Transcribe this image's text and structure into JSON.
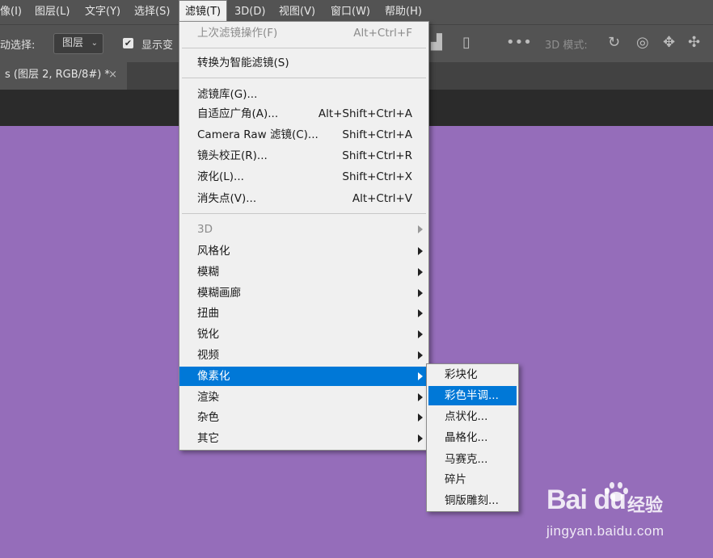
{
  "menubar": {
    "items": [
      "像(I)",
      "图层(L)",
      "文字(Y)",
      "选择(S)",
      "滤镜(T)",
      "3D(D)",
      "视图(V)",
      "窗口(W)",
      "帮助(H)"
    ],
    "active_index": 4
  },
  "options_bar": {
    "auto_select_label": "动选择:",
    "auto_select_value": "图层",
    "show_transform_label": "显示变",
    "mode_3d_label": "3D 模式:"
  },
  "document_tab": {
    "title": "s (图层 2, RGB/8#) *",
    "close": "×"
  },
  "filter_menu": {
    "items": [
      {
        "label": "上次滤镜操作(F)",
        "shortcut": "Alt+Ctrl+F",
        "disabled": true
      },
      {
        "separator": true
      },
      {
        "label": "转换为智能滤镜(S)"
      },
      {
        "separator": true
      },
      {
        "label": "滤镜库(G)..."
      },
      {
        "label": "自适应广角(A)...",
        "shortcut": "Alt+Shift+Ctrl+A"
      },
      {
        "label": "Camera Raw 滤镜(C)...",
        "shortcut": "Shift+Ctrl+A"
      },
      {
        "label": "镜头校正(R)...",
        "shortcut": "Shift+Ctrl+R"
      },
      {
        "label": "液化(L)...",
        "shortcut": "Shift+Ctrl+X"
      },
      {
        "label": "消失点(V)...",
        "shortcut": "Alt+Ctrl+V"
      },
      {
        "separator": true
      },
      {
        "label": "3D",
        "submenu": true,
        "disabled": true
      },
      {
        "label": "风格化",
        "submenu": true
      },
      {
        "label": "模糊",
        "submenu": true
      },
      {
        "label": "模糊画廊",
        "submenu": true
      },
      {
        "label": "扭曲",
        "submenu": true
      },
      {
        "label": "锐化",
        "submenu": true
      },
      {
        "label": "视频",
        "submenu": true
      },
      {
        "label": "像素化",
        "submenu": true,
        "highlighted": true
      },
      {
        "label": "渲染",
        "submenu": true
      },
      {
        "label": "杂色",
        "submenu": true
      },
      {
        "label": "其它",
        "submenu": true
      }
    ]
  },
  "pixelate_submenu": {
    "items": [
      {
        "label": "彩块化"
      },
      {
        "label": "彩色半调...",
        "highlighted": true
      },
      {
        "label": "点状化..."
      },
      {
        "label": "晶格化..."
      },
      {
        "label": "马赛克..."
      },
      {
        "label": "碎片"
      },
      {
        "label": "铜版雕刻..."
      }
    ]
  },
  "watermark": {
    "brand": "Bai du",
    "cn": "经验",
    "url": "jingyan.baidu.com"
  },
  "colors": {
    "canvas": "#956dba",
    "menu_bg": "#f0f0f0",
    "highlight": "#0078d7",
    "chrome": "#535353"
  }
}
